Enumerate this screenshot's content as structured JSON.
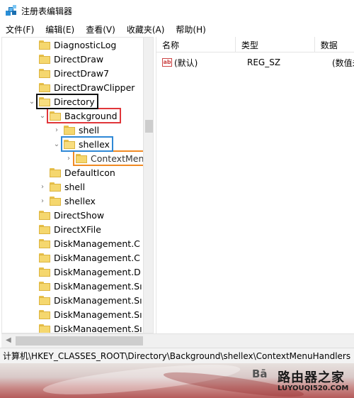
{
  "window": {
    "title": "注册表编辑器"
  },
  "menu": [
    "文件(F)",
    "编辑(E)",
    "查看(V)",
    "收藏夹(A)",
    "帮助(H)"
  ],
  "tree": [
    {
      "label": "DiagnosticLog",
      "level": 2,
      "expander": "",
      "highlight": ""
    },
    {
      "label": "DirectDraw",
      "level": 2,
      "expander": "",
      "highlight": ""
    },
    {
      "label": "DirectDraw7",
      "level": 2,
      "expander": "",
      "highlight": ""
    },
    {
      "label": "DirectDrawClipper",
      "level": 2,
      "expander": "",
      "highlight": ""
    },
    {
      "label": "Directory",
      "level": 2,
      "expander": "down",
      "highlight": "black"
    },
    {
      "label": "Background",
      "level": 3,
      "expander": "down",
      "highlight": "red"
    },
    {
      "label": "shell",
      "level": 4,
      "expander": "right",
      "highlight": ""
    },
    {
      "label": "shellex",
      "level": 4,
      "expander": "down",
      "highlight": "blue"
    },
    {
      "label": "ContextMenuHandlers",
      "level": 5,
      "expander": "right",
      "highlight": "orange"
    },
    {
      "label": "DefaultIcon",
      "level": 3,
      "expander": "",
      "highlight": ""
    },
    {
      "label": "shell",
      "level": 3,
      "expander": "right",
      "highlight": ""
    },
    {
      "label": "shellex",
      "level": 3,
      "expander": "right",
      "highlight": ""
    },
    {
      "label": "DirectShow",
      "level": 2,
      "expander": "",
      "highlight": ""
    },
    {
      "label": "DirectXFile",
      "level": 2,
      "expander": "",
      "highlight": ""
    },
    {
      "label": "DiskManagement.C",
      "level": 2,
      "expander": "",
      "highlight": ""
    },
    {
      "label": "DiskManagement.C",
      "level": 2,
      "expander": "",
      "highlight": ""
    },
    {
      "label": "DiskManagement.D",
      "level": 2,
      "expander": "",
      "highlight": ""
    },
    {
      "label": "DiskManagement.Sı",
      "level": 2,
      "expander": "",
      "highlight": ""
    },
    {
      "label": "DiskManagement.Sı",
      "level": 2,
      "expander": "",
      "highlight": ""
    },
    {
      "label": "DiskManagement.Sı",
      "level": 2,
      "expander": "",
      "highlight": ""
    },
    {
      "label": "DiskManagement.Sı",
      "level": 2,
      "expander": "",
      "highlight": ""
    }
  ],
  "list": {
    "headers": [
      "名称",
      "类型",
      "数据"
    ],
    "rows": [
      {
        "name": "(默认)",
        "type": "REG_SZ",
        "data": "(数值未"
      }
    ],
    "value_icon": "ab"
  },
  "statusbar": {
    "path": "计算机\\HKEY_CLASSES_ROOT\\Directory\\Background\\shellex\\ContextMenuHandlers"
  },
  "watermark": {
    "left": "Bā",
    "main": "路由器之家",
    "sub": "LUYOUQI520.COM"
  },
  "colors": {
    "highlight_black": "#111111",
    "highlight_red": "#e0363a",
    "highlight_blue": "#2e88d6",
    "highlight_orange": "#f08a24",
    "folder": "#f5d76e"
  }
}
